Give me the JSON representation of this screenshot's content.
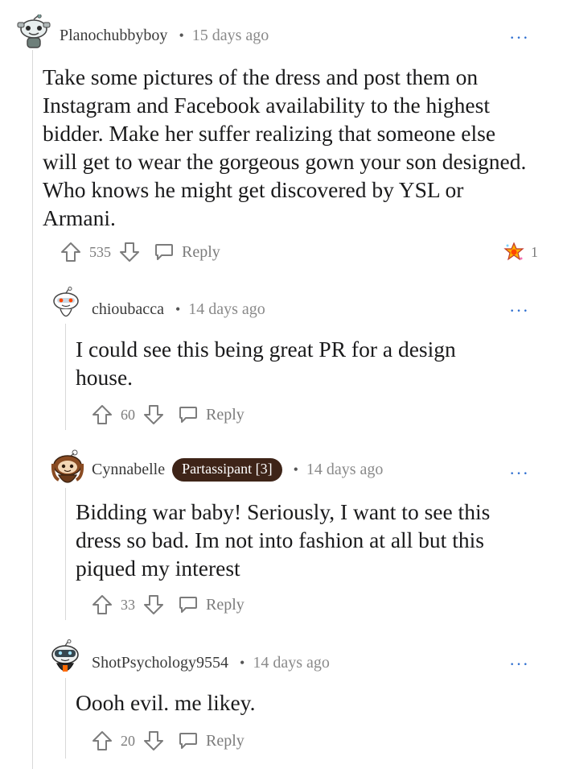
{
  "comments": [
    {
      "username": "Planochubbyboy",
      "separator": "•",
      "time": "15 days ago",
      "more": "···",
      "body": "Take some pictures of the dress and post them on Instagram and Facebook availability to the highest bidder. Make her suffer realizing that someone else will get to wear the gorgeous gown your son designed. Who knows he might get discovered by YSL or Armani.",
      "votes": "535",
      "reply": "Reply",
      "award_count": "1"
    },
    {
      "username": "chioubacca",
      "separator": "•",
      "time": "14 days ago",
      "more": "···",
      "body": "I could see this being great PR for a design house.",
      "votes": "60",
      "reply": "Reply"
    },
    {
      "username": "Cynnabelle",
      "flair": "Partassipant [3]",
      "separator": "•",
      "time": "14 days ago",
      "more": "···",
      "body": "Bidding war baby! Seriously, I want to see this dress so bad. Im not into fashion at all but this piqued my interest",
      "votes": "33",
      "reply": "Reply"
    },
    {
      "username": "ShotPsychology9554",
      "separator": "•",
      "time": "14 days ago",
      "more": "···",
      "body": "Oooh evil. me likey.",
      "votes": "20",
      "reply": "Reply"
    }
  ],
  "colors": {
    "flair_bg": "#3e2418",
    "more_dots": "#2f6fd0",
    "thread_line": "#d8d8d8"
  }
}
